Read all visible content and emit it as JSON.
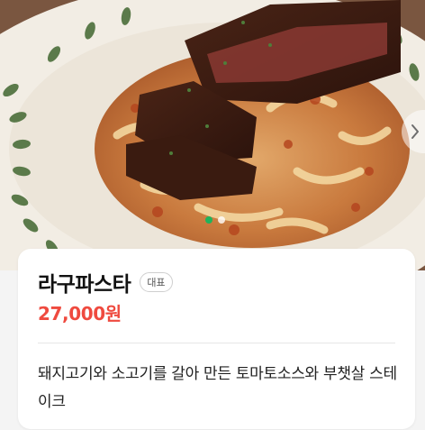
{
  "menu": {
    "name": "라구파스타",
    "badge": "대표",
    "price": "27,000원",
    "description": "돼지고기와 소고기를 갈아 만든 토마토소스와 부챗살 스테이크"
  },
  "carousel": {
    "total": 2,
    "active_index": 0
  },
  "colors": {
    "price": "#ef4a3f",
    "active_dot": "#1fb35c",
    "card_background": "#ffffff",
    "page_background": "#f4f4f4"
  },
  "icons": {
    "next": "chevron-right-icon"
  }
}
